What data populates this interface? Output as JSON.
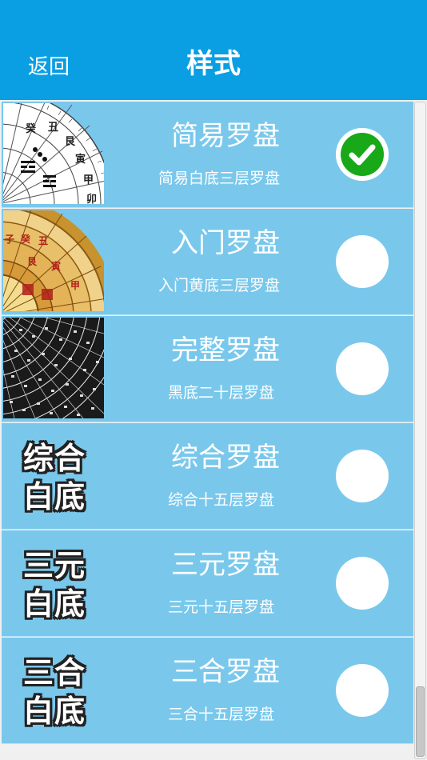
{
  "header": {
    "back_label": "返回",
    "title": "样式"
  },
  "items": [
    {
      "name": "简易罗盘",
      "sub": "简易白底三层罗盘",
      "checked": true,
      "thumb_text": [],
      "glyphs": [
        "癸",
        "丑",
        "艮",
        "寅",
        "甲",
        "卯"
      ]
    },
    {
      "name": "入门罗盘",
      "sub": "入门黄底三层罗盘",
      "checked": false,
      "thumb_text": [],
      "glyphs": [
        "子",
        "癸",
        "丑",
        "艮",
        "寅",
        "甲"
      ]
    },
    {
      "name": "完整罗盘",
      "sub": "黑底二十层罗盘",
      "checked": false,
      "thumb_text": []
    },
    {
      "name": "综合罗盘",
      "sub": "综合十五层罗盘",
      "checked": false,
      "thumb_text": [
        "综合",
        "白底"
      ]
    },
    {
      "name": "三元罗盘",
      "sub": "三元十五层罗盘",
      "checked": false,
      "thumb_text": [
        "三元",
        "白底"
      ]
    },
    {
      "name": "三合罗盘",
      "sub": "三合十五层罗盘",
      "checked": false,
      "thumb_text": [
        "三合",
        "白底"
      ]
    }
  ],
  "colors": {
    "header_bg": "#0a9ee3",
    "row_bg": "#79c8ec",
    "check_green": "#18a818"
  },
  "icons": {
    "checked": "checkmark-circle-icon",
    "unchecked": "empty-circle-icon"
  }
}
